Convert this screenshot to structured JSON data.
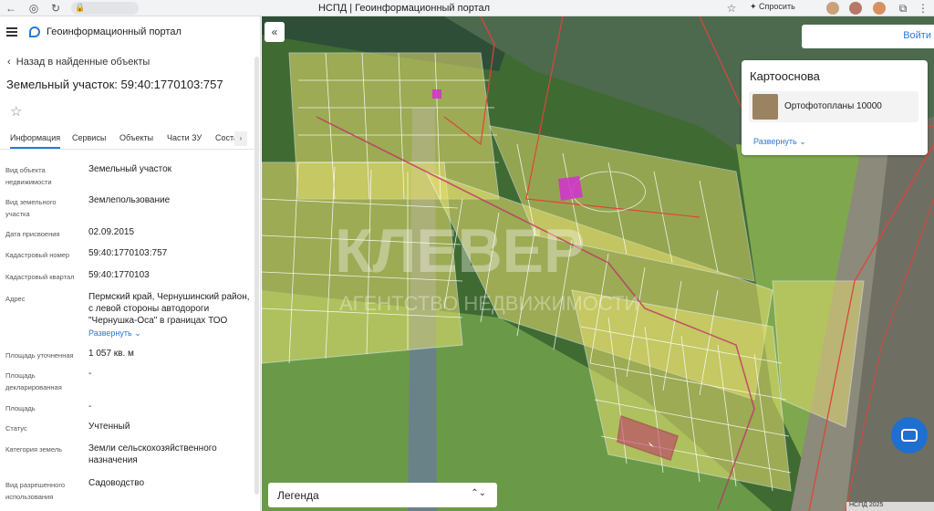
{
  "browser": {
    "tab_title": "НСПД | Геоинформационный портал",
    "ask_label": "Спросить",
    "url_hint": "◦"
  },
  "panel": {
    "portal_title": "Геоинформационный портал",
    "back_link": "Назад в найденные объекты",
    "object_title": "Земельный участок: 59:40:1770103:757",
    "tabs": [
      "Информация",
      "Сервисы",
      "Объекты",
      "Части ЗУ",
      "Соста"
    ],
    "fields": [
      {
        "label": "Вид объекта недвижимости",
        "value": "Земельный участок"
      },
      {
        "label": "Вид земельного участка",
        "value": "Землепользование"
      },
      {
        "label": "Дата присвоения",
        "value": "02.09.2015"
      },
      {
        "label": "Кадастровый номер",
        "value": "59:40:1770103:757"
      },
      {
        "label": "Кадастровый квартал",
        "value": "59:40:1770103"
      },
      {
        "label": "Адрес",
        "value": "Пермский край, Чернушинский район, с левой стороны автодороги \"Чернушка-Оса\" в границах ТОО"
      },
      {
        "label": "Площадь уточненная",
        "value": "1 057 кв. м"
      },
      {
        "label": "Площадь декларированная",
        "value": "-"
      },
      {
        "label": "Площадь",
        "value": "-"
      },
      {
        "label": "Статус",
        "value": "Учтенный"
      },
      {
        "label": "Категория земель",
        "value": "Земли сельскохозяйственного назначения"
      },
      {
        "label": "Вид разрешенного использования",
        "value": "Садоводство"
      }
    ],
    "address_expand": "Развернуть"
  },
  "map": {
    "login": "Войти",
    "basemap_title": "Картооснова",
    "basemap_item": "Ортофотопланы 10000",
    "basemap_expand": "Развернуть",
    "legend": "Легенда",
    "attribution": "НСПД 2025",
    "watermark_main": "КЛЕВЕР",
    "watermark_sub": "АГЕНТСТВО НЕДВИЖИМОСТИ"
  },
  "colors": {
    "accent": "#2a7ad5",
    "parcel_fill": "#e8e070",
    "parcel_line": "#ffffff",
    "boundary_red": "#e0443a",
    "selected": "#c0306a"
  }
}
